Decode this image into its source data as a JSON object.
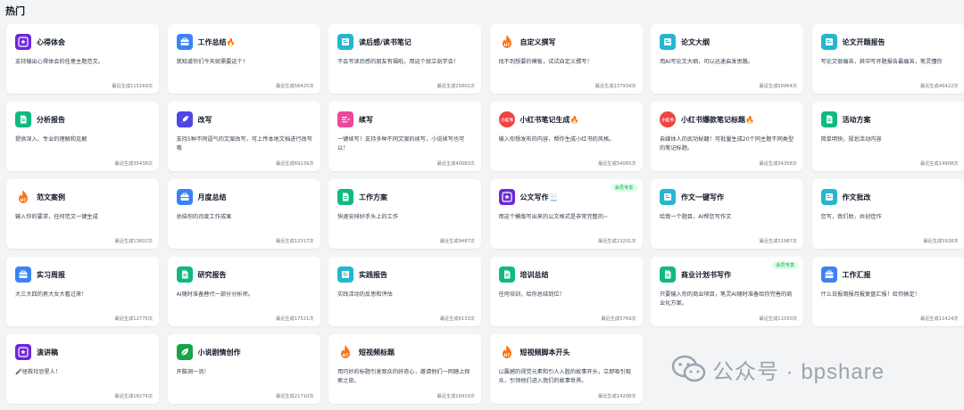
{
  "section_title": "热门",
  "vip_badge": "会员专享",
  "colors": {
    "blue": "#3b82f6",
    "teal": "#22b8cf",
    "purple": "#7c3aed",
    "orange": "#f97316",
    "green": "#10b981",
    "pink": "#ec4899",
    "red": "#ef4444"
  },
  "cards": [
    {
      "title": "心得体会",
      "emoji": "",
      "icon": "purple-star-icon",
      "color": "#6d28d9",
      "desc": "支持输出心得体会的任意主题范文。",
      "usage": "最近生成115169次"
    },
    {
      "title": "工作总结",
      "emoji": "🔥",
      "icon": "briefcase-icon",
      "color": "#3b82f6",
      "desc": "我知道你们今天就需要这个！",
      "usage": "最近生成56425次"
    },
    {
      "title": "读后感/读书笔记",
      "emoji": "",
      "icon": "book-icon",
      "color": "#22b8cf",
      "desc": "不会写读后感的朋友有福啦，用这个就立刻学会！",
      "usage": "最近生成25802次"
    },
    {
      "title": "自定义撰写",
      "emoji": "",
      "icon": "ht-flame-icon",
      "color": "#f97316",
      "desc": "找不到想要的模板，试试自定义撰写！",
      "usage": "最近生成137934次"
    },
    {
      "title": "论文大纲",
      "emoji": "",
      "icon": "book-icon",
      "color": "#22b8cf",
      "desc": "用AI写论文大纲，可以迅速启发思路。",
      "usage": "最近生成50964次"
    },
    {
      "title": "论文开题报告",
      "emoji": "",
      "icon": "book-icon",
      "color": "#22b8cf",
      "desc": "写论文很痛苦，其中写开题报告最痛苦，笔灵懂你",
      "usage": "最近生成46422次"
    },
    {
      "title": "分析报告",
      "emoji": "",
      "icon": "document-icon",
      "color": "#10b981",
      "desc": "提供深入、专业的理解和见解",
      "usage": "最近生成35438次"
    },
    {
      "title": "改写",
      "emoji": "",
      "icon": "rocket-icon",
      "color": "#4f46e5",
      "desc": "支持5种不同语气的文案改写，可上传本地文档进行改写哦",
      "usage": "最近生成69239次"
    },
    {
      "title": "续写",
      "emoji": "",
      "icon": "pen-lines-icon",
      "color": "#ec4899",
      "desc": "一键续写！支持多种不同文案的续写，小说续写也可以！",
      "usage": "最近生成40083次"
    },
    {
      "title": "小红书笔记生成",
      "emoji": "🔥",
      "icon": "xiaohongshu-icon",
      "color": "#ef4444",
      "desc": "输入你想发布的内容，帮你生成小红书的风格。",
      "usage": "最近生成54065次"
    },
    {
      "title": "小红书爆款笔记标题",
      "emoji": "🔥",
      "icon": "xiaohongshu-icon",
      "color": "#ef4444",
      "desc": "自媒体人的武功秘籍！可批量生成20个同主题不同类型的笔记标题。",
      "usage": "最近生成34358次"
    },
    {
      "title": "活动方案",
      "emoji": "",
      "icon": "document-icon",
      "color": "#10b981",
      "desc": "简单明快，规划活动内容",
      "usage": "最近生成14908次"
    },
    {
      "title": "范文案例",
      "emoji": "",
      "icon": "ht-flame-icon",
      "color": "#f97316",
      "desc": "输入你的要求，任何范文一键生成",
      "usage": "最近生成13802次"
    },
    {
      "title": "月度总结",
      "emoji": "",
      "icon": "briefcase-icon",
      "color": "#3b82f6",
      "desc": "总结你的月度工作成果",
      "usage": "最近生成12317次"
    },
    {
      "title": "工作方案",
      "emoji": "",
      "icon": "document-icon",
      "color": "#10b981",
      "desc": "快速安排好手头上的工作",
      "usage": "最近生成9487次"
    },
    {
      "title": "公文写作",
      "emoji": "📃",
      "icon": "purple-star-icon",
      "color": "#6d28d9",
      "desc": "用这个模版写出来的公文格式是非常完整的~",
      "usage": "最近生成13201次",
      "vip": true
    },
    {
      "title": "作文一键写作",
      "emoji": "",
      "icon": "book-icon",
      "color": "#22b8cf",
      "desc": "给我一个题目，AI帮您写作文",
      "usage": "最近生成31987次"
    },
    {
      "title": "作文批改",
      "emoji": "",
      "icon": "book-icon",
      "color": "#22b8cf",
      "desc": "您写，我们助，共创佳作",
      "usage": "最近生成5928次"
    },
    {
      "title": "实习周报",
      "emoji": "",
      "icon": "briefcase-icon",
      "color": "#3b82f6",
      "desc": "大三大四的男大女大看过来！",
      "usage": "最近生成12775次"
    },
    {
      "title": "研究报告",
      "emoji": "",
      "icon": "document-icon",
      "color": "#10b981",
      "desc": "AI随时准备替代一部分分析师。",
      "usage": "最近生成17521次"
    },
    {
      "title": "实践报告",
      "emoji": "",
      "icon": "book-icon",
      "color": "#22b8cf",
      "desc": "实践活动的反思和评估",
      "usage": "最近生成6133次"
    },
    {
      "title": "培训总结",
      "emoji": "",
      "icon": "document-icon",
      "color": "#10b981",
      "desc": "任何培训，给你总结到位！",
      "usage": "最近生成5769次"
    },
    {
      "title": "商业计划书写作",
      "emoji": "",
      "icon": "document-icon",
      "color": "#10b981",
      "desc": "只要输入你的商业项目，笔灵AI随时准备给你完善的商业化方案。",
      "usage": "最近生成11050次",
      "vip": true
    },
    {
      "title": "工作汇报",
      "emoji": "",
      "icon": "briefcase-icon",
      "color": "#3b82f6",
      "desc": "什么日报周报月报复盘汇报！给你搞定！",
      "usage": "最近生成11424次"
    },
    {
      "title": "演讲稿",
      "emoji": "",
      "icon": "purple-star-icon",
      "color": "#6d28d9",
      "desc": "🎤拯救社恐星人！",
      "usage": "最近生成18274次"
    },
    {
      "title": "小说剧情创作",
      "emoji": "",
      "icon": "leaf-icon",
      "color": "#16a34a",
      "desc": "开脑洞一流！",
      "usage": "最近生成21710次"
    },
    {
      "title": "短视频标题",
      "emoji": "",
      "icon": "ht-flame-icon",
      "color": "#f97316",
      "desc": "用巧妙的标题引发观众的好奇心，邀请他们一同踏上探索之旅。",
      "usage": "最近生成16910次"
    },
    {
      "title": "短视频脚本开头",
      "emoji": "",
      "icon": "ht-flame-icon",
      "color": "#f97316",
      "desc": "以震撼的视觉元素和引人入胜的故事开头，立即吸引观众，引领他们进入我们的故事世界。",
      "usage": "最近生成14208次"
    }
  ],
  "watermark": {
    "text": "公众号 · bpshare"
  }
}
